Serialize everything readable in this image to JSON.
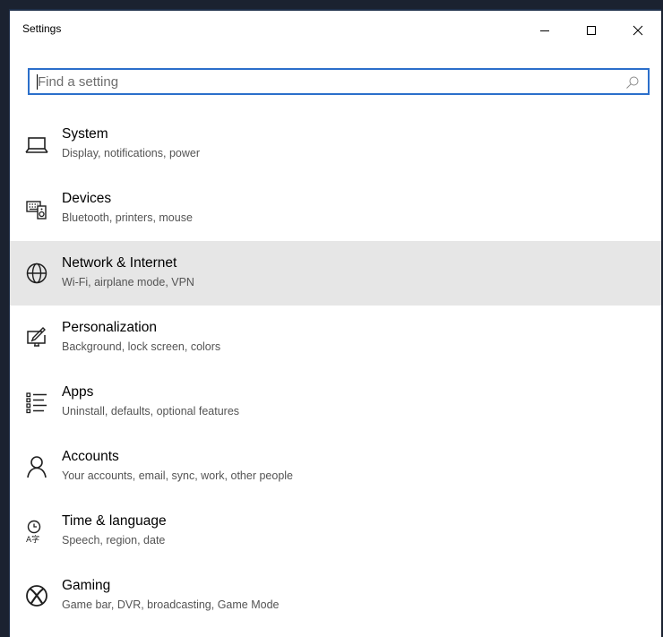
{
  "window": {
    "title": "Settings",
    "minimize_icon": "minimize-icon",
    "maximize_icon": "maximize-icon",
    "close_icon": "close-icon"
  },
  "search": {
    "placeholder": "Find a setting",
    "value": "",
    "icon": "search-icon",
    "border_color": "#2b6fcb"
  },
  "categories": [
    {
      "title": "System",
      "description": "Display, notifications, power",
      "icon": "laptop-icon",
      "selected": false
    },
    {
      "title": "Devices",
      "description": "Bluetooth, printers, mouse",
      "icon": "keyboard-speaker-icon",
      "selected": false
    },
    {
      "title": "Network & Internet",
      "description": "Wi-Fi, airplane mode, VPN",
      "icon": "globe-icon",
      "selected": true
    },
    {
      "title": "Personalization",
      "description": "Background, lock screen, colors",
      "icon": "paint-screen-icon",
      "selected": false
    },
    {
      "title": "Apps",
      "description": "Uninstall, defaults, optional features",
      "icon": "app-list-icon",
      "selected": false
    },
    {
      "title": "Accounts",
      "description": "Your accounts, email, sync, work, other people",
      "icon": "person-icon",
      "selected": false
    },
    {
      "title": "Time & language",
      "description": "Speech, region, date",
      "icon": "clock-language-icon",
      "selected": false
    },
    {
      "title": "Gaming",
      "description": "Game bar, DVR, broadcasting, Game Mode",
      "icon": "xbox-icon",
      "selected": false
    }
  ],
  "colors": {
    "selected_row": "#e6e6e6",
    "icon_stroke": "#1f1f1f",
    "desc_text": "#545454"
  }
}
